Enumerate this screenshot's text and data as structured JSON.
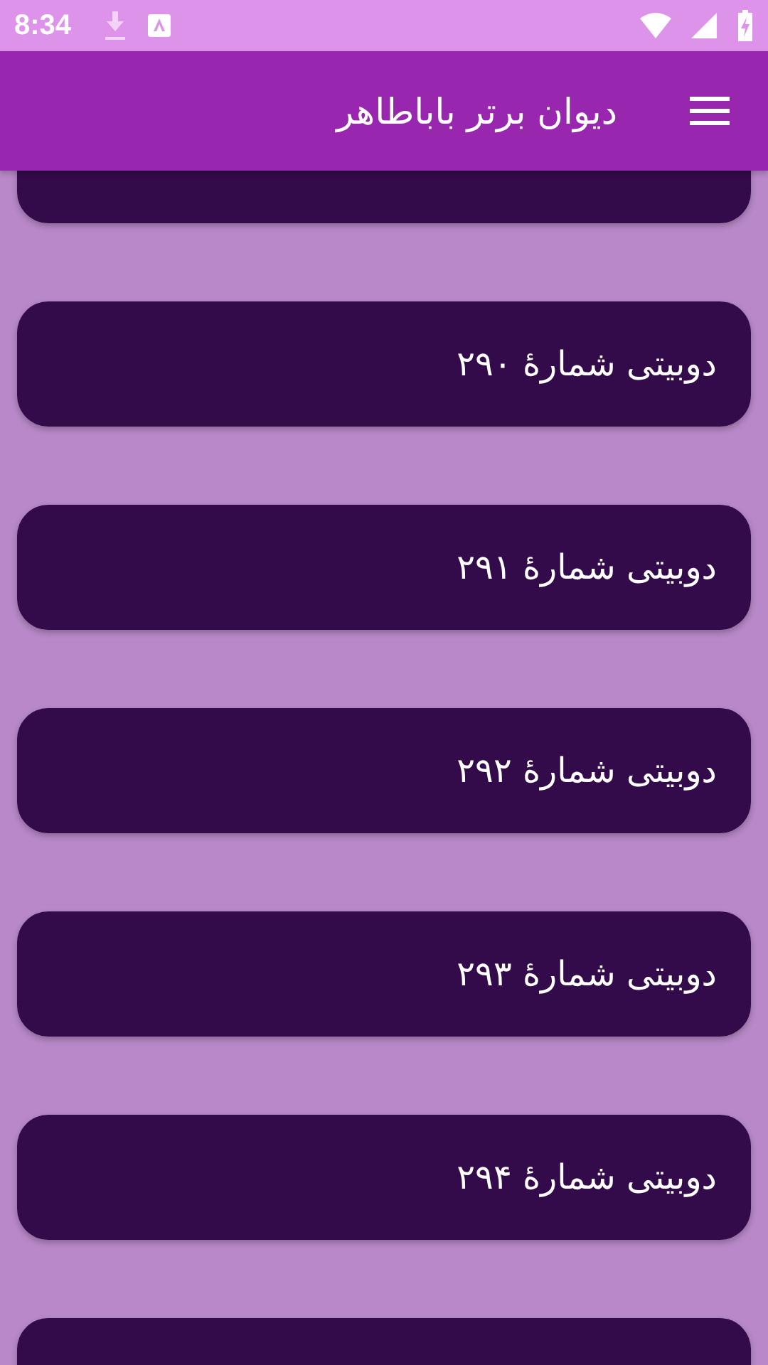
{
  "status_bar": {
    "time": "8:34"
  },
  "app_bar": {
    "title": "دیوان برتر باباطاهر"
  },
  "items": [
    {
      "kind": "clipped"
    },
    {
      "kind": "entry",
      "title": "دوبیتی شمارهٔ ۲۹۰"
    },
    {
      "kind": "entry",
      "title": "دوبیتی شمارهٔ ۲۹۱"
    },
    {
      "kind": "entry",
      "title": "دوبیتی شمارهٔ ۲۹۲"
    },
    {
      "kind": "entry",
      "title": "دوبیتی شمارهٔ ۲۹۳"
    },
    {
      "kind": "entry",
      "title": "دوبیتی شمارهٔ ۲۹۴"
    },
    {
      "kind": "clipped"
    }
  ]
}
